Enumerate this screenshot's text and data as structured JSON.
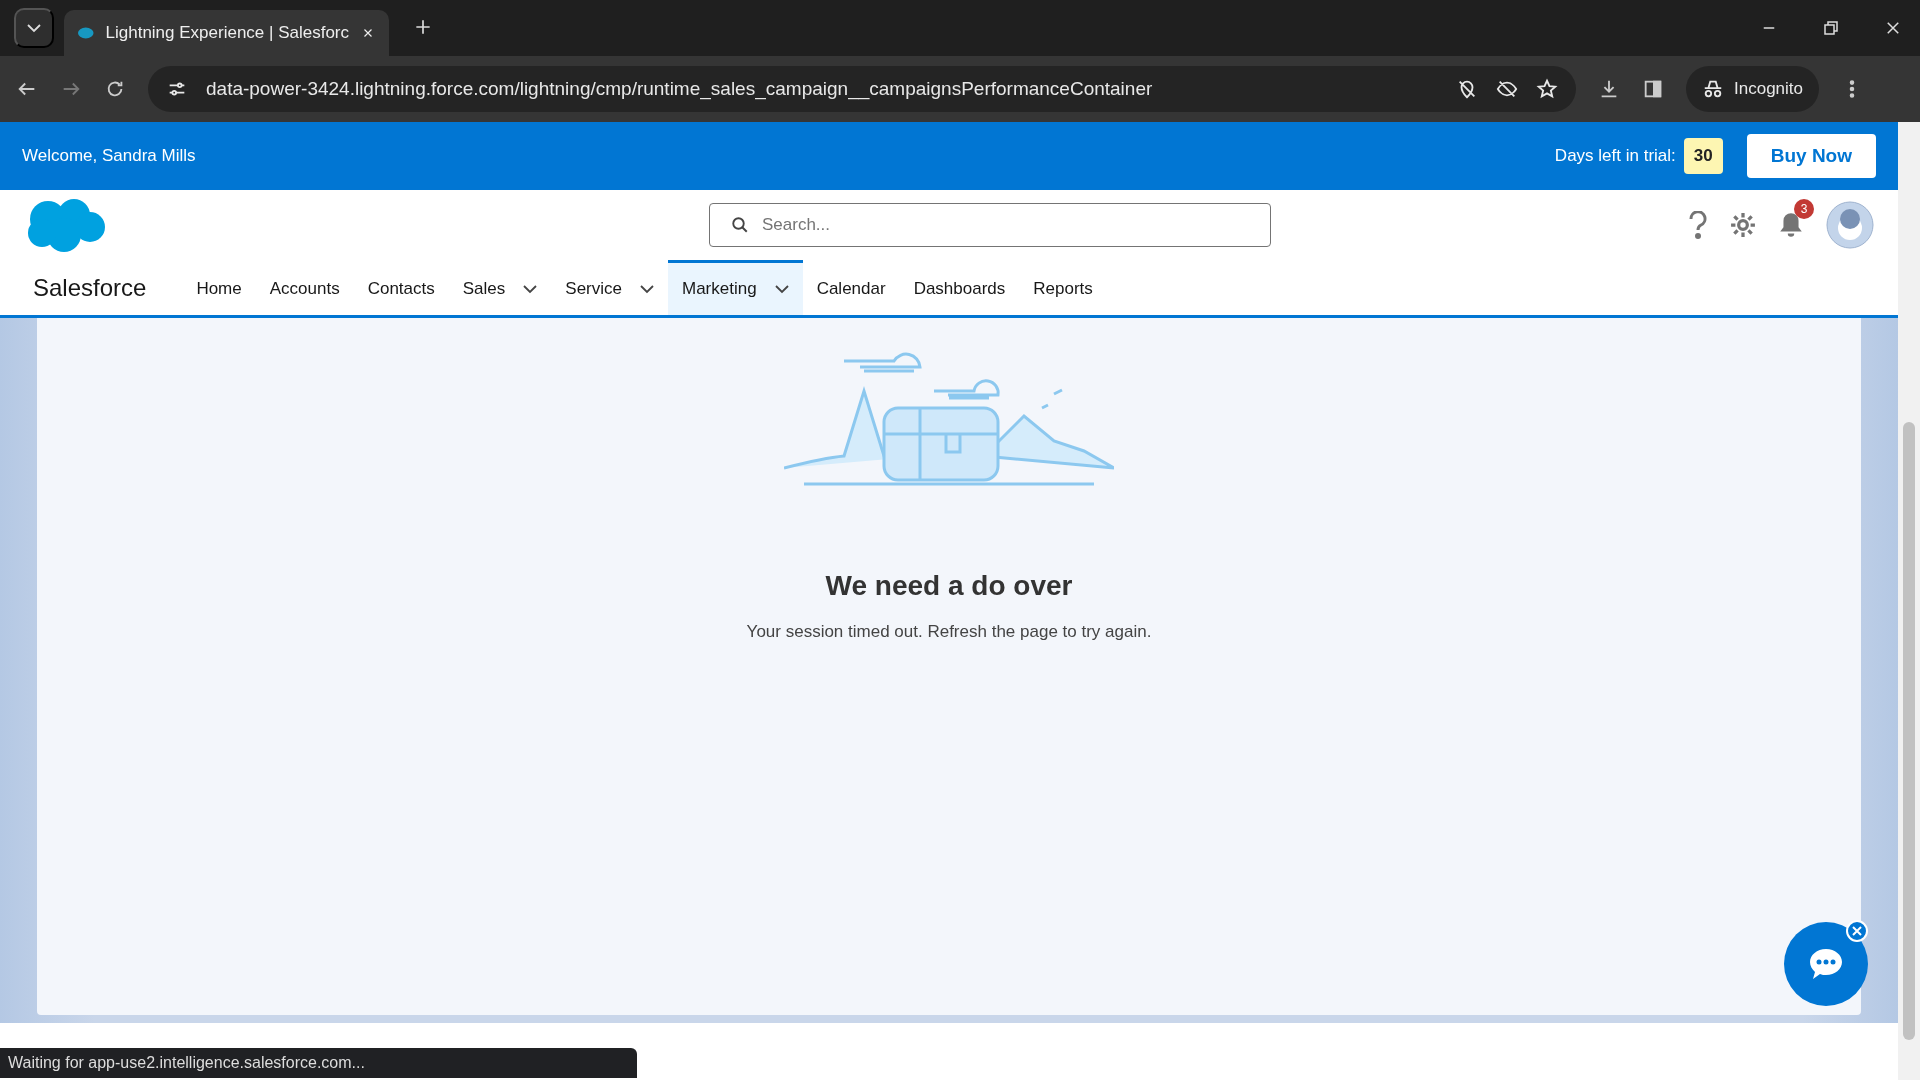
{
  "browser": {
    "tab_title": "Lightning Experience | Salesforc",
    "url": "data-power-3424.lightning.force.com/lightning/cmp/runtime_sales_campaign__campaignsPerformanceContainer",
    "profile": "Incognito"
  },
  "trial_bar": {
    "welcome": "Welcome, Sandra Mills",
    "days_label": "Days left in trial:",
    "days": "30",
    "buy_button": "Buy Now"
  },
  "header": {
    "app_name": "Salesforce",
    "search": {
      "placeholder": "Search..."
    },
    "notification_count": "3"
  },
  "nav": [
    {
      "label": "Home",
      "has_menu": false,
      "selected": false
    },
    {
      "label": "Accounts",
      "has_menu": false,
      "selected": false
    },
    {
      "label": "Contacts",
      "has_menu": false,
      "selected": false
    },
    {
      "label": "Sales",
      "has_menu": true,
      "selected": false
    },
    {
      "label": "Service",
      "has_menu": true,
      "selected": false
    },
    {
      "label": "Marketing",
      "has_menu": true,
      "selected": true
    },
    {
      "label": "Calendar",
      "has_menu": false,
      "selected": false
    },
    {
      "label": "Dashboards",
      "has_menu": false,
      "selected": false
    },
    {
      "label": "Reports",
      "has_menu": false,
      "selected": false
    }
  ],
  "message": {
    "title": "We need a do over",
    "text": "Your session timed out. Refresh the page to try again."
  },
  "status_bar": "Waiting for app-use2.intelligence.salesforce.com..."
}
